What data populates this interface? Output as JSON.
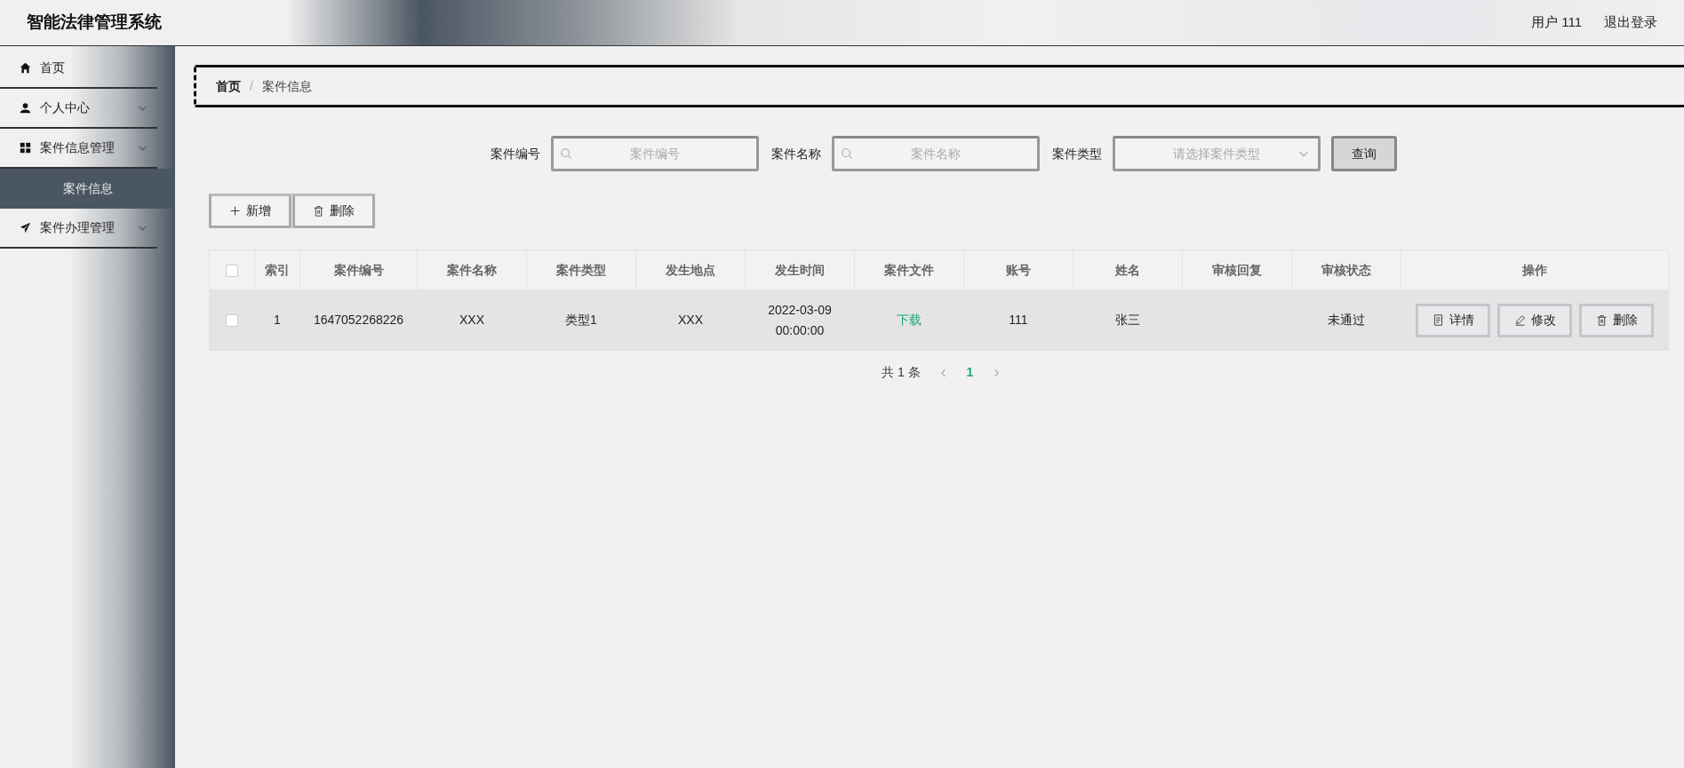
{
  "header": {
    "title": "智能法律管理系统",
    "user": "用户 111",
    "logout": "退出登录"
  },
  "sidebar": {
    "items": [
      {
        "kind": "link",
        "label": "首页",
        "selected": false
      },
      {
        "kind": "group",
        "label": "个人中心",
        "selected": false
      },
      {
        "kind": "group",
        "label": "案件信息管理",
        "selected": false,
        "children": [
          {
            "label": "案件信息",
            "selected": true
          }
        ]
      },
      {
        "kind": "group",
        "label": "案件办理管理",
        "selected": false
      }
    ]
  },
  "breadcrumb": {
    "separator": "/",
    "items": [
      "首页",
      "案件信息"
    ]
  },
  "search": {
    "fields": [
      {
        "kind": "text",
        "label": "案件编号",
        "placeholder": "案件编号"
      },
      {
        "kind": "text",
        "label": "案件名称",
        "placeholder": "案件名称"
      },
      {
        "kind": "select",
        "label": "案件类型",
        "placeholder": "请选择案件类型"
      }
    ],
    "button": "查询"
  },
  "actions": [
    {
      "kind": "add",
      "label": "新增"
    },
    {
      "kind": "delete",
      "label": "删除"
    }
  ],
  "table": {
    "select_all_checked": false,
    "columns": [
      "索引",
      "案件编号",
      "案件名称",
      "案件类型",
      "发生地点",
      "发生时间",
      "案件文件",
      "账号",
      "姓名",
      "审核回复",
      "审核状态",
      "操作"
    ],
    "rows": [
      {
        "checked": false,
        "cells": [
          "1",
          "1647052268226",
          "XXX",
          "类型1",
          "XXX",
          "2022-03-09 00:00:00",
          "下载",
          "111",
          "张三",
          "",
          "未通过"
        ],
        "buttons": [
          {
            "kind": "detail",
            "label": "详情"
          },
          {
            "kind": "edit",
            "label": "修改"
          },
          {
            "kind": "delete",
            "label": "删除"
          }
        ]
      }
    ]
  },
  "pagination": {
    "total": "共 1 条",
    "pages": [
      {
        "label": "1",
        "selected": true
      }
    ]
  }
}
